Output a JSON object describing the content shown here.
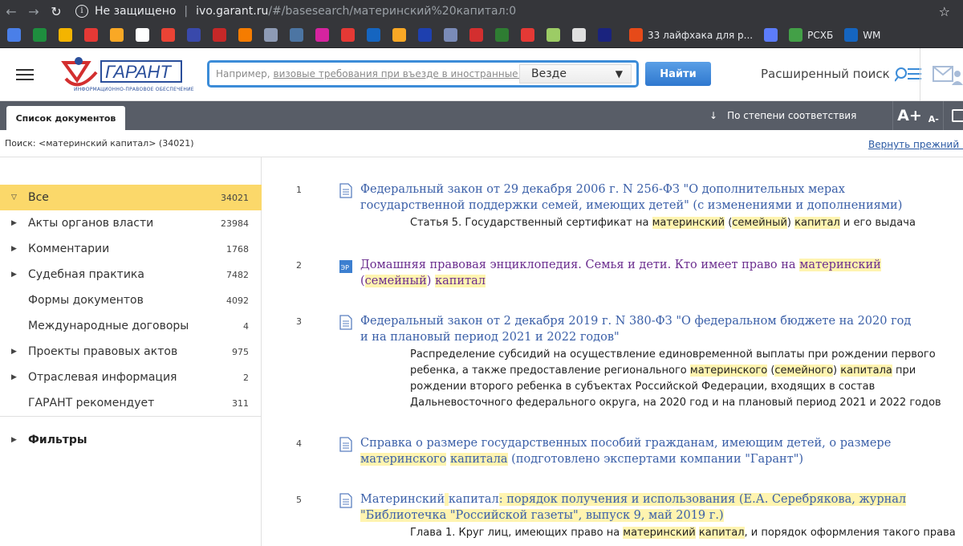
{
  "browser": {
    "insecure_label": "Не защищено",
    "url_host": "ivo.garant.ru",
    "url_path": "/#/basesearch/материнский%20капитал:0",
    "bookmarks": [
      {
        "icon": "docs-icon",
        "color": "#4a7fe8"
      },
      {
        "icon": "sheets-icon",
        "color": "#1e8e3e"
      },
      {
        "icon": "drive-icon",
        "color": "#f4b400"
      },
      {
        "icon": "pinwheel-icon",
        "color": "#e53935"
      },
      {
        "icon": "grid-icon",
        "color": "#f9a825"
      },
      {
        "icon": "star-icon",
        "color": "#ffffff"
      },
      {
        "icon": "gmail-icon",
        "color": "#ea4335"
      },
      {
        "icon": "tracker-icon",
        "color": "#3949ab"
      },
      {
        "icon": "code-icon",
        "color": "#c62828"
      },
      {
        "icon": "analytics-icon",
        "color": "#f57c00"
      },
      {
        "icon": "store-icon",
        "color": "#8e9bb5"
      },
      {
        "icon": "vk-icon",
        "color": "#4c75a3"
      },
      {
        "icon": "instagram-icon",
        "color": "#d6249f"
      },
      {
        "icon": "fire-icon",
        "color": "#e53935"
      },
      {
        "icon": "photo-icon",
        "color": "#1565c0"
      },
      {
        "icon": "shield-icon",
        "color": "#f9a825"
      },
      {
        "icon": "flag-icon",
        "color": "#1e40af"
      },
      {
        "icon": "globe-star-icon",
        "color": "#7a8bb8"
      },
      {
        "icon": "hh-icon",
        "color": "#d32f2f"
      },
      {
        "icon": "check-icon",
        "color": "#2e7d32"
      },
      {
        "icon": "metro-icon",
        "color": "#e53935"
      },
      {
        "icon": "cross-icon",
        "color": "#9ccc65"
      },
      {
        "icon": "globe-icon",
        "color": "#e0e0e0"
      },
      {
        "icon": "eu-icon",
        "color": "#1a237e"
      }
    ],
    "labeled_bookmarks": [
      {
        "icon": "layfhak-icon",
        "color": "#e64a19",
        "label": "33 лайфхака для р..."
      },
      {
        "icon": "bird-icon",
        "color": "#5c7cfa",
        "label": ""
      },
      {
        "icon": "rshb-icon",
        "color": "#43a047",
        "label": "РСХБ"
      },
      {
        "icon": "wm-icon",
        "color": "#1565c0",
        "label": "WM"
      }
    ]
  },
  "header": {
    "logo_sub": "ИНФОРМАЦИОННО-ПРАВОВОЕ ОБЕСПЕЧЕНИЕ",
    "search_placeholder_prefix": "Например,",
    "search_placeholder_link": "визовые требования при въезде в иностранные государства",
    "scope": "Везде",
    "find_button": "Найти",
    "advanced_search": "Расширенный поиск"
  },
  "tabs": {
    "active_tab": "Список документов",
    "sort": "По степени соответствия",
    "font_big": "A",
    "font_big_plus": "+",
    "font_small": "A",
    "font_small_minus": "-"
  },
  "search_info": {
    "query": "Поиск: <материнский капитал> (34021)",
    "back_link": "Вернуть прежний вид"
  },
  "sidebar": {
    "items": [
      {
        "label": "Все",
        "count": "34021",
        "expand": "open"
      },
      {
        "label": "Акты органов власти",
        "count": "23984",
        "expand": "closed"
      },
      {
        "label": "Комментарии",
        "count": "1768",
        "expand": "closed"
      },
      {
        "label": "Судебная практика",
        "count": "7482",
        "expand": "closed"
      },
      {
        "label": "Формы документов",
        "count": "4092",
        "expand": "none"
      },
      {
        "label": "Международные договоры",
        "count": "4",
        "expand": "none"
      },
      {
        "label": "Проекты правовых актов",
        "count": "975",
        "expand": "closed"
      },
      {
        "label": "Отраслевая информация",
        "count": "2",
        "expand": "closed"
      },
      {
        "label": "ГАРАНТ рекомендует",
        "count": "311",
        "expand": "none"
      }
    ],
    "filters": "Фильтры"
  },
  "results": [
    {
      "num": "1",
      "icon": "document-icon",
      "title": "Федеральный закон от 29 декабря 2006 г. N 256-ФЗ \"О дополнительных мерах государственной поддержки семей, имеющих детей\" (с изменениями и дополнениями)",
      "snippet": [
        "Статья 5. Государственный сертификат на ",
        "материнский",
        " (",
        "семейный",
        ") ",
        "капитал",
        " и его выдача"
      ]
    },
    {
      "num": "2",
      "icon": "encyclopedia-icon",
      "icon_label": "ЭР",
      "title_parts": [
        "Домашняя правовая энциклопедия. Семья и дети. Кто имеет право на ",
        "материнский",
        " (",
        "семейный",
        ") ",
        "капитал"
      ]
    },
    {
      "num": "3",
      "icon": "document-icon",
      "title": "Федеральный закон от 2 декабря 2019 г. N 380-ФЗ \"О федеральном бюджете на 2020 год и на плановый период 2021 и 2022 годов\"",
      "snippet": [
        "Распределение субсидий на осуществление единовременной выплаты при рождении первого ребенка, а также предоставление регионального ",
        "материнского",
        " (",
        "семейного",
        ") ",
        "капитала",
        " при рождении второго ребенка в субъектах Российской Федерации, входящих в состав Дальневосточного федерального округа, на 2020 год и на плановый период 2021 и 2022 годов"
      ]
    },
    {
      "num": "4",
      "icon": "document-icon",
      "title_parts": [
        "Справка о размере государственных пособий гражданам, имеющим детей, о размере ",
        "материнского",
        " ",
        "капитала",
        " (подготовлено экспертами компании \"Гарант\")"
      ]
    },
    {
      "num": "5",
      "icon": "document-icon",
      "title_parts": [
        "Материнский",
        " ",
        "капитал",
        ": порядок получения и использования (Е.А. Серебрякова, журнал \"Библиотечка \"Российской газеты\", выпуск 9, май 2019 г.)"
      ],
      "snippet": [
        "Глава 1. Круг лиц, имеющих право на ",
        "материнский",
        " ",
        "капитал",
        ", и порядок оформления такого права"
      ]
    }
  ]
}
